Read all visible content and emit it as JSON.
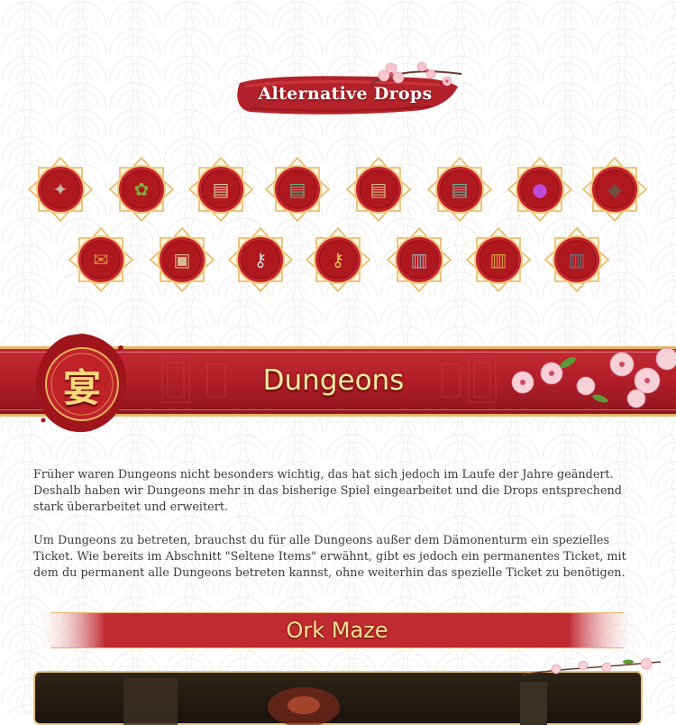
{
  "alternative_drops": {
    "title": "Alternative Drops",
    "items": [
      {
        "name": "fan-icon",
        "glyph": "✦",
        "color": "#c9b8a8"
      },
      {
        "name": "bouquet-icon",
        "glyph": "✿",
        "color": "#7fae3a"
      },
      {
        "name": "book-tan-icon",
        "glyph": "▤",
        "color": "#d8c49a"
      },
      {
        "name": "book-green-icon",
        "glyph": "▤",
        "color": "#6aa67a"
      },
      {
        "name": "book-tan-2-icon",
        "glyph": "▤",
        "color": "#d6b887"
      },
      {
        "name": "book-teal-icon",
        "glyph": "▤",
        "color": "#6ab39a"
      },
      {
        "name": "purple-orb-icon",
        "glyph": "●",
        "color": "#c04ad8"
      },
      {
        "name": "ore-chunk-icon",
        "glyph": "◆",
        "color": "#6b5040"
      },
      {
        "name": "scroll-bundle-icon",
        "glyph": "✉",
        "color": "#e09040"
      },
      {
        "name": "paper-horse-icon",
        "glyph": "▣",
        "color": "#d8b890"
      },
      {
        "name": "silver-key-icon",
        "glyph": "⚷",
        "color": "#d8d8d8"
      },
      {
        "name": "gold-key-icon",
        "glyph": "⚷",
        "color": "#e8c050"
      },
      {
        "name": "chest-silver-icon",
        "glyph": "▥",
        "color": "#a8a8b0"
      },
      {
        "name": "chest-gold-icon",
        "glyph": "▥",
        "color": "#d8a040"
      },
      {
        "name": "chest-dark-icon",
        "glyph": "▥",
        "color": "#707078"
      }
    ]
  },
  "dungeons": {
    "seal_char": "宴",
    "title": "Dungeons",
    "paragraphs": [
      "Früher waren Dungeons nicht besonders wichtig, das hat sich jedoch im Laufe der Jahre geändert. Deshalb haben wir Dungeons mehr in das bisherige Spiel eingearbeitet und die Drops entsprechend stark überarbeitet und erweitert.",
      "Um Dungeons zu betreten, brauchst du für alle Dungeons außer dem Dämonenturm ein spezielles Ticket.  Wie bereits im Abschnitt \"Seltene Items\" erwähnt, gibt es jedoch ein permanentes Ticket, mit dem du permanent alle Dungeons betreten kannst, ohne weiterhin das spezielle Ticket zu benötigen."
    ]
  },
  "ork_maze": {
    "title": "Ork Maze"
  },
  "colors": {
    "banner_red": "#b01e28",
    "gold": "#e9b24a",
    "text": "#3c3c3c"
  }
}
